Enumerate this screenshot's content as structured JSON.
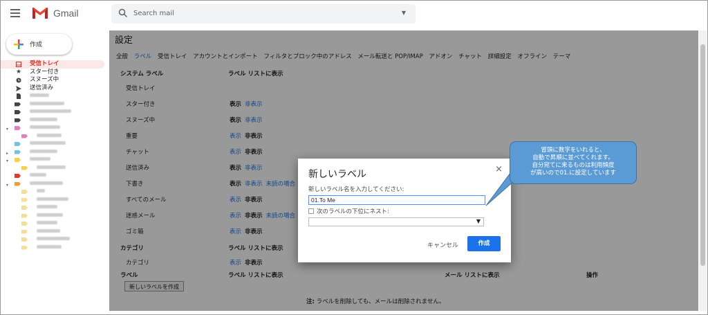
{
  "header": {
    "brand": "Gmail",
    "search_placeholder": "Search mail",
    "search_caret": "▼"
  },
  "sidebar": {
    "compose_label": "作成",
    "items": [
      {
        "label": "受信トレイ",
        "icon": "inbox-icon"
      },
      {
        "label": "スター付き",
        "icon": "star-icon"
      },
      {
        "label": "スヌーズ中",
        "icon": "clock-icon"
      },
      {
        "label": "送信済み",
        "icon": "send-icon"
      }
    ]
  },
  "settings": {
    "title": "設定",
    "tabs": [
      "全般",
      "ラベル",
      "受信トレイ",
      "アカウントとインポート",
      "フィルタとブロック中のアドレス",
      "メール転送と POP/IMAP",
      "アドオン",
      "チャット",
      "詳細設定",
      "オフライン",
      "テーマ"
    ],
    "selected_tab": "ラベル",
    "system_header": "システム ラベル",
    "list_header": "ラベル リストに表示",
    "rows": [
      {
        "name": "受信トレイ",
        "show": "",
        "hide": "",
        "unread": ""
      },
      {
        "name": "スター付き",
        "show": "表示",
        "hide": "非表示",
        "unread": ""
      },
      {
        "name": "スヌーズ中",
        "show": "表示",
        "hide": "非表示",
        "unread": ""
      },
      {
        "name": "重要",
        "show": "表示",
        "hide": "非表示",
        "unread": ""
      },
      {
        "name": "チャット",
        "show": "表示",
        "hide": "非表示",
        "unread": ""
      },
      {
        "name": "送信済み",
        "show": "表示",
        "hide": "非表示",
        "unread": ""
      },
      {
        "name": "下書き",
        "show": "表示",
        "hide": "非表示",
        "unread": "未読の場合"
      },
      {
        "name": "すべてのメール",
        "show": "表示",
        "hide": "非表示",
        "unread": ""
      },
      {
        "name": "迷惑メール",
        "show": "表示",
        "hide": "非表示",
        "unread": "未読の場合"
      },
      {
        "name": "ゴミ箱",
        "show": "表示",
        "hide": "非表示",
        "unread": ""
      }
    ],
    "category_header": "カテゴリ",
    "category_list_header": "ラベル リストに表示",
    "category_row": {
      "name": "カテゴリ",
      "show": "表示",
      "hide": "非表示"
    },
    "label_header": "ラベル",
    "label_list_header": "ラベル リストに表示",
    "mail_list_header": "メール リストに表示",
    "action_header": "操作",
    "new_label_button": "新しいラベルを作成",
    "note_bold": "注:",
    "note_text": " ラベルを削除しても、メールは削除されません。"
  },
  "dialog": {
    "title": "新しいラベル",
    "close": "×",
    "name_prompt": "新しいラベル名を入力してください:",
    "name_value": "01.To Me",
    "nest_label": "次のラベルの下位にネスト:",
    "nest_value": "",
    "select_caret": "▼",
    "cancel": "キャンセル",
    "create": "作成"
  },
  "callout": {
    "lines": [
      "冒頭に数字をいれると、",
      "自動で昇順に並べてくれます。",
      "自分宛てに来るものは利用頻度",
      "が高いので01.に設定しています"
    ]
  },
  "colors": {
    "accent": "#1a73e8",
    "active_nav": "#d93025",
    "callout": "#5b9bd5"
  }
}
